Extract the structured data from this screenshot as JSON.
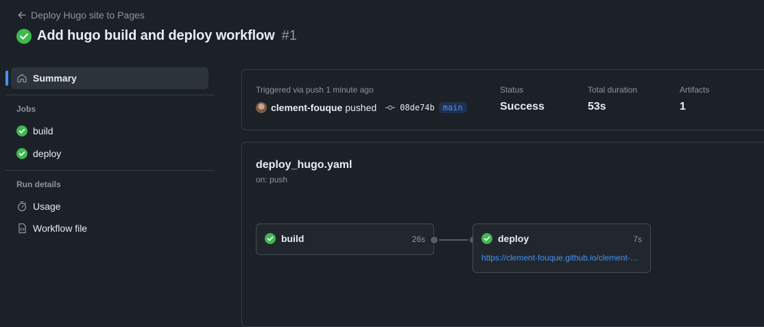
{
  "header": {
    "back_label": "Deploy Hugo site to Pages",
    "title": "Add hugo build and deploy workflow",
    "run_number": "#1"
  },
  "sidebar": {
    "summary_label": "Summary",
    "jobs_heading": "Jobs",
    "jobs": [
      {
        "label": "build",
        "status": "success"
      },
      {
        "label": "deploy",
        "status": "success"
      }
    ],
    "run_details_heading": "Run details",
    "usage_label": "Usage",
    "workflow_file_label": "Workflow file"
  },
  "summary": {
    "triggered": "Triggered via push 1 minute ago",
    "user": "clement-fouque",
    "action": "pushed",
    "commit": "08de74b",
    "branch": "main",
    "status_label": "Status",
    "status_value": "Success",
    "duration_label": "Total duration",
    "duration_value": "53s",
    "artifacts_label": "Artifacts",
    "artifacts_value": "1"
  },
  "workflow": {
    "file": "deploy_hugo.yaml",
    "trigger": "on: push",
    "jobs": [
      {
        "name": "build",
        "duration": "26s"
      },
      {
        "name": "deploy",
        "duration": "7s",
        "url": "https://clement-fouque.github.io/clement-fouque"
      }
    ]
  },
  "colors": {
    "success": "#3fb950",
    "accent": "#4493f8",
    "background": "#1c2128"
  }
}
